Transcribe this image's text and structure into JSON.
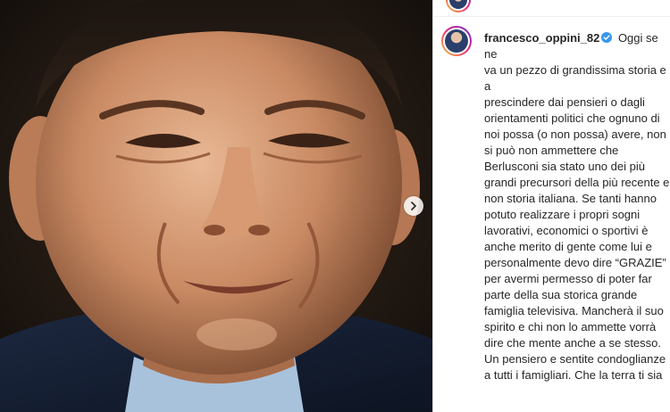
{
  "post": {
    "username": "francesco_oppini_82",
    "verified_icon": "verified-badge-icon",
    "caption_first": " Oggi se ne",
    "caption_rest": "va un pezzo di grandissima storia e a\nprescindere dai pensieri o dagli\norientamenti politici che ognuno di\nnoi possa (o non possa) avere, non\nsi può non ammettere che\nBerlusconi sia stato uno dei più\ngrandi precursori della più recente e\nnon storia italiana. Se tanti hanno\npotuto realizzare i propri sogni\nlavorativi, economici o sportivi è\nanche merito di gente come lui e\npersonalmente devo dire “GRAZIE”\nper avermi permesso di poter far\nparte della sua storica grande\nfamiglia televisiva. Mancherà il suo\nspirito e chi non lo ammette vorrà\ndire che mente anche a se stesso.\nUn pensiero e sentite condoglianze\na tutti i famigliari. Che la terra ti sia"
  },
  "colors": {
    "text": "#262626",
    "verified": "#3897f0",
    "divider": "#dbdbdb"
  },
  "icons": {
    "next": "chevron-right-icon",
    "avatar": "profile-avatar"
  }
}
